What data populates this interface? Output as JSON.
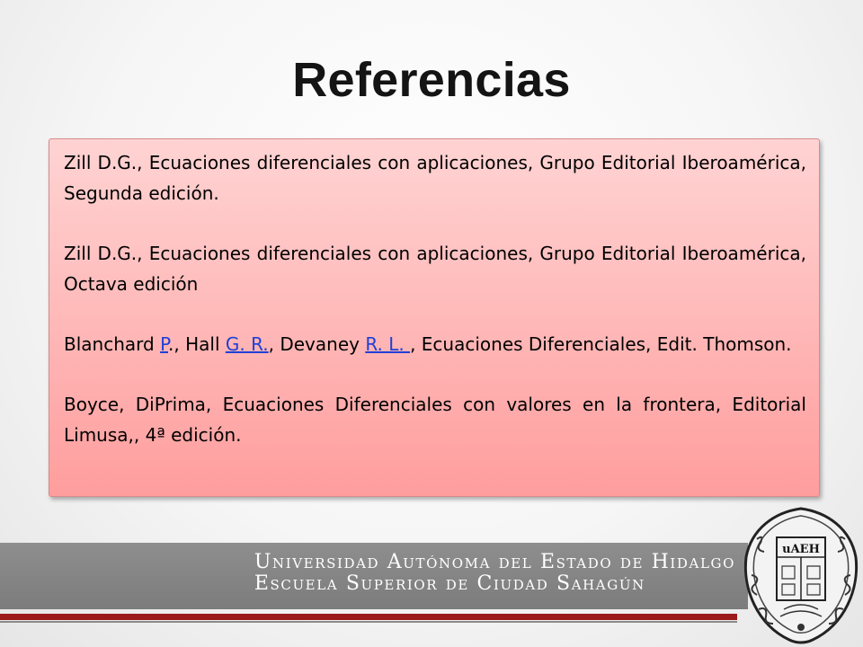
{
  "slide": {
    "title": "Referencias",
    "references": [
      {
        "text": "Zill D.G., Ecuaciones diferenciales con aplicaciones, Grupo Editorial Iberoamérica, Segunda edición."
      },
      {
        "text": "Zill D.G., Ecuaciones diferenciales con aplicaciones, Grupo Editorial Iberoamérica, Octava edición"
      },
      {
        "parts": {
          "a": "Blanchard ",
          "link1": "P",
          "b": "., Hall ",
          "link2": "G. R.",
          "c": ", Devaney ",
          "link3": "R. L. ",
          "d": ", Ecuaciones Diferenciales, Edit. Thomson."
        }
      },
      {
        "text": "Boyce, DiPrima, Ecuaciones Diferenciales con valores en la frontera, Editorial Limusa,, 4ª edición."
      }
    ]
  },
  "footer": {
    "university": "Universidad Autónoma del Estado de Hidalgo",
    "school": "Escuela Superior de Ciudad Sahagún",
    "seal_text": "uAEH"
  },
  "colors": {
    "link": "#1f3fd6",
    "box_top": "#ffd3d3",
    "box_bottom": "#ff9d9d",
    "banner": "#868686",
    "accent_red": "#9b1b1b"
  }
}
